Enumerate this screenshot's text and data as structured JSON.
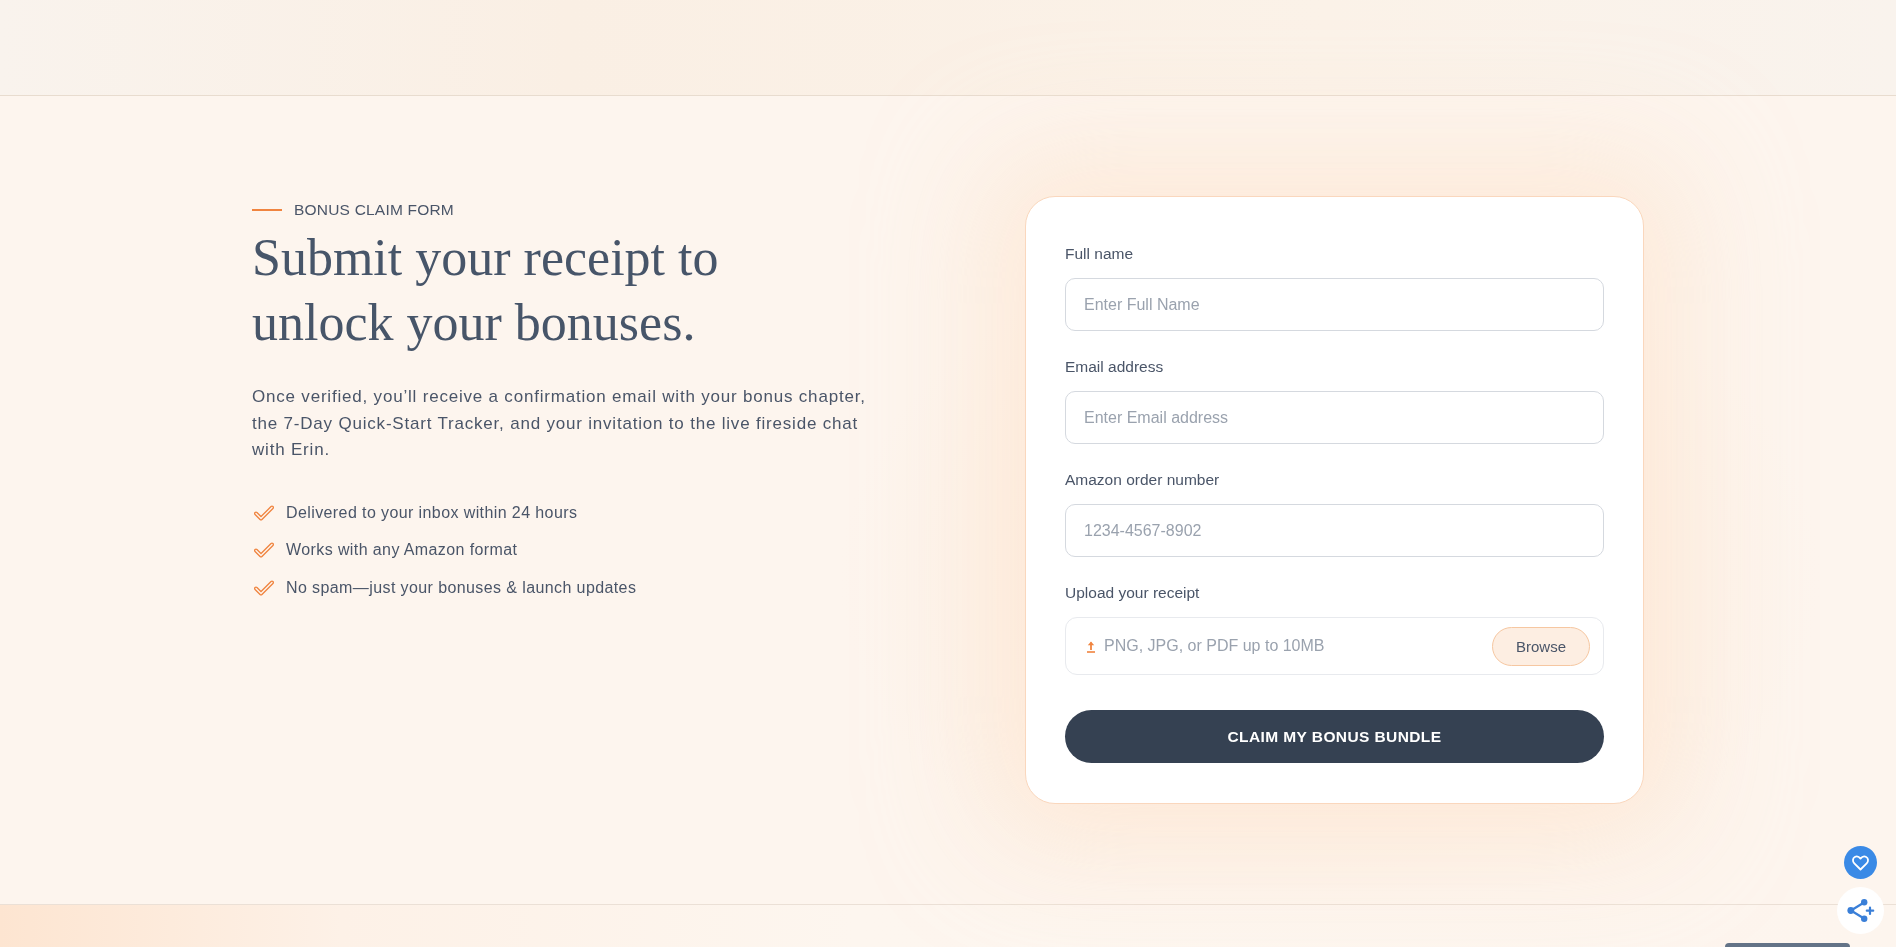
{
  "intro": {
    "eyebrow": "BONUS CLAIM FORM",
    "heading": "Submit your receipt to unlock your bonuses.",
    "description": "Once verified, you’ll receive a confirmation email with your bonus chapter, the 7-Day Quick-Start Tracker, and your invitation to the live fireside chat with Erin.",
    "benefits": [
      "Delivered to your inbox within 24 hours",
      "Works with any Amazon format",
      "No spam—just your bonuses & launch updates"
    ]
  },
  "form": {
    "fields": [
      {
        "kind": "text",
        "label": "Full name",
        "placeholder": "Enter Full Name"
      },
      {
        "kind": "text",
        "label": "Email address",
        "placeholder": "Enter Email address"
      },
      {
        "kind": "text",
        "label": "Amazon order number",
        "placeholder": "1234-4567-8902"
      },
      {
        "kind": "file",
        "label": "Upload your receipt",
        "placeholder": "PNG, JPG, or PDF up to 10MB",
        "button": "Browse"
      }
    ],
    "submit": "CLAIM MY BONUS BUNDLE"
  }
}
